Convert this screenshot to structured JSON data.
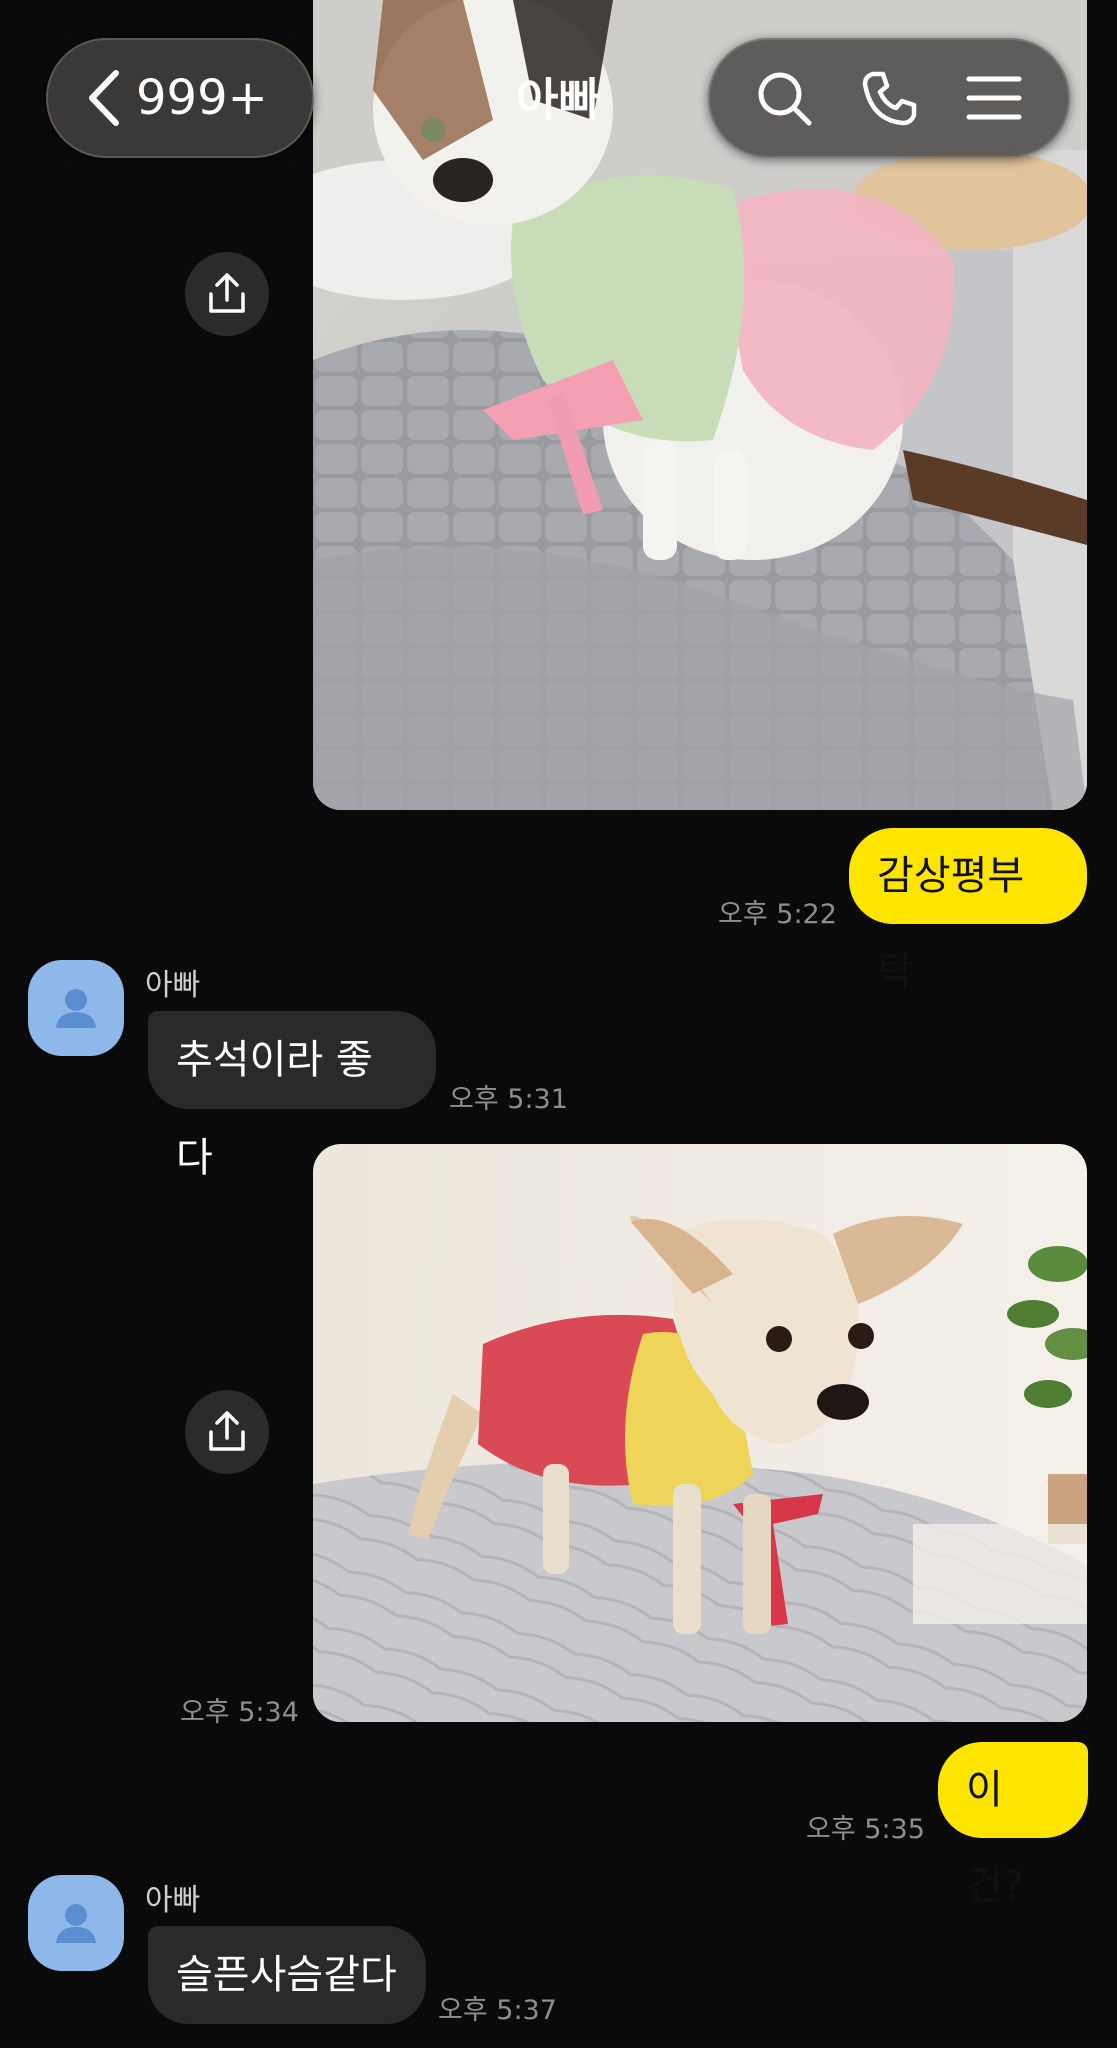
{
  "header": {
    "back_count": "999+",
    "title": "아빠"
  },
  "messages": {
    "m1": {
      "text": "감상평부탁",
      "time": "오후 5:22"
    },
    "m2": {
      "sender": "아빠",
      "text": "추석이라 좋다",
      "time": "오후 5:31"
    },
    "m3": {
      "time": "오후 5:34"
    },
    "m4": {
      "text": "이건?",
      "time": "오후 5:35"
    },
    "m5": {
      "sender": "아빠",
      "text": "슬픈사슴같다",
      "time": "오후 5:37"
    }
  },
  "colors": {
    "my_bubble": "#fee500",
    "other_bubble": "#2a2a2a",
    "avatar": "#8fb8ea",
    "background": "#0a0a0a"
  },
  "icons": [
    "chevron-left-icon",
    "search-icon",
    "phone-icon",
    "menu-icon",
    "share-icon",
    "person-icon"
  ]
}
